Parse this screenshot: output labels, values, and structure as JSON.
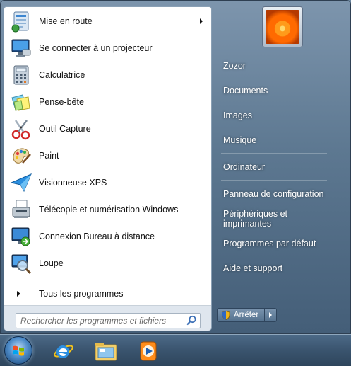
{
  "start_menu": {
    "programs": [
      {
        "label": "Mise en route",
        "icon": "getting-started-icon",
        "has_submenu": true
      },
      {
        "label": "Se connecter à un projecteur",
        "icon": "projector-icon"
      },
      {
        "label": "Calculatrice",
        "icon": "calculator-icon"
      },
      {
        "label": "Pense-bête",
        "icon": "sticky-notes-icon"
      },
      {
        "label": "Outil Capture",
        "icon": "snipping-tool-icon"
      },
      {
        "label": "Paint",
        "icon": "paint-icon"
      },
      {
        "label": "Visionneuse XPS",
        "icon": "xps-viewer-icon"
      },
      {
        "label": "Télécopie et numérisation Windows",
        "icon": "fax-scan-icon"
      },
      {
        "label": "Connexion Bureau à distance",
        "icon": "remote-desktop-icon"
      },
      {
        "label": "Loupe",
        "icon": "magnifier-icon"
      }
    ],
    "all_programs": "Tous les programmes",
    "search_placeholder": "Rechercher les programmes et fichiers",
    "right_links": [
      {
        "label": "Zozor"
      },
      {
        "label": "Documents"
      },
      {
        "label": "Images"
      },
      {
        "label": "Musique"
      },
      {
        "label": "Ordinateur"
      },
      {
        "label": "Panneau de configuration"
      },
      {
        "label": "Périphériques et imprimantes"
      },
      {
        "label": "Programmes par défaut"
      },
      {
        "label": "Aide et support"
      }
    ],
    "shutdown_label": "Arrêter"
  },
  "taskbar": {
    "items": [
      {
        "icon": "start-orb-icon"
      },
      {
        "icon": "internet-explorer-icon"
      },
      {
        "icon": "file-explorer-icon"
      },
      {
        "icon": "media-player-icon"
      }
    ]
  }
}
